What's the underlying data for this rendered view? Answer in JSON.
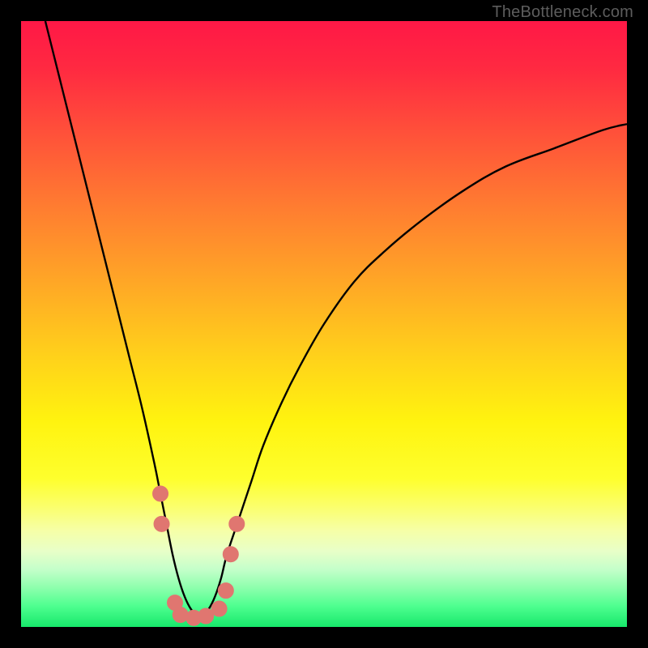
{
  "watermark": "TheBottleneck.com",
  "colors": {
    "frame_border": "#000000",
    "curve_stroke": "#000000",
    "marker_fill": "#e07670",
    "marker_stroke": "#e07670",
    "gradient_stops": [
      {
        "offset": 0.0,
        "color": "#ff1846"
      },
      {
        "offset": 0.08,
        "color": "#ff2a41"
      },
      {
        "offset": 0.18,
        "color": "#ff4f3a"
      },
      {
        "offset": 0.3,
        "color": "#ff7a31"
      },
      {
        "offset": 0.42,
        "color": "#ffa327"
      },
      {
        "offset": 0.55,
        "color": "#ffd01b"
      },
      {
        "offset": 0.66,
        "color": "#fff30f"
      },
      {
        "offset": 0.755,
        "color": "#feff2d"
      },
      {
        "offset": 0.8,
        "color": "#fbff6a"
      },
      {
        "offset": 0.84,
        "color": "#f6ffa6"
      },
      {
        "offset": 0.875,
        "color": "#e8ffc8"
      },
      {
        "offset": 0.905,
        "color": "#c4ffca"
      },
      {
        "offset": 0.935,
        "color": "#8effad"
      },
      {
        "offset": 0.965,
        "color": "#4fff90"
      },
      {
        "offset": 1.0,
        "color": "#17e86b"
      }
    ]
  },
  "chart_data": {
    "type": "line",
    "title": "",
    "xlabel": "",
    "ylabel": "",
    "xlim": [
      0,
      100
    ],
    "ylim": [
      0,
      100
    ],
    "series": [
      {
        "name": "bottleneck-curve",
        "x": [
          4,
          6,
          8,
          10,
          12,
          14,
          16,
          18,
          20,
          22,
          23,
          24,
          25,
          26,
          27,
          28,
          29,
          30,
          31,
          32,
          33,
          34,
          36,
          38,
          40,
          43,
          46,
          50,
          55,
          60,
          66,
          73,
          80,
          88,
          96,
          100
        ],
        "y": [
          100,
          92,
          84,
          76,
          68,
          60,
          52,
          44,
          36,
          27,
          22,
          17,
          12,
          8,
          5,
          3,
          2,
          2,
          3,
          5,
          8,
          12,
          18,
          24,
          30,
          37,
          43,
          50,
          57,
          62,
          67,
          72,
          76,
          79,
          82,
          83
        ]
      }
    ],
    "markers": [
      {
        "x": 23.0,
        "y": 22
      },
      {
        "x": 23.2,
        "y": 17
      },
      {
        "x": 25.4,
        "y": 4
      },
      {
        "x": 26.3,
        "y": 2
      },
      {
        "x": 28.5,
        "y": 1.5
      },
      {
        "x": 30.5,
        "y": 1.8
      },
      {
        "x": 32.7,
        "y": 3
      },
      {
        "x": 33.8,
        "y": 6
      },
      {
        "x": 34.6,
        "y": 12
      },
      {
        "x": 35.6,
        "y": 17
      }
    ]
  }
}
